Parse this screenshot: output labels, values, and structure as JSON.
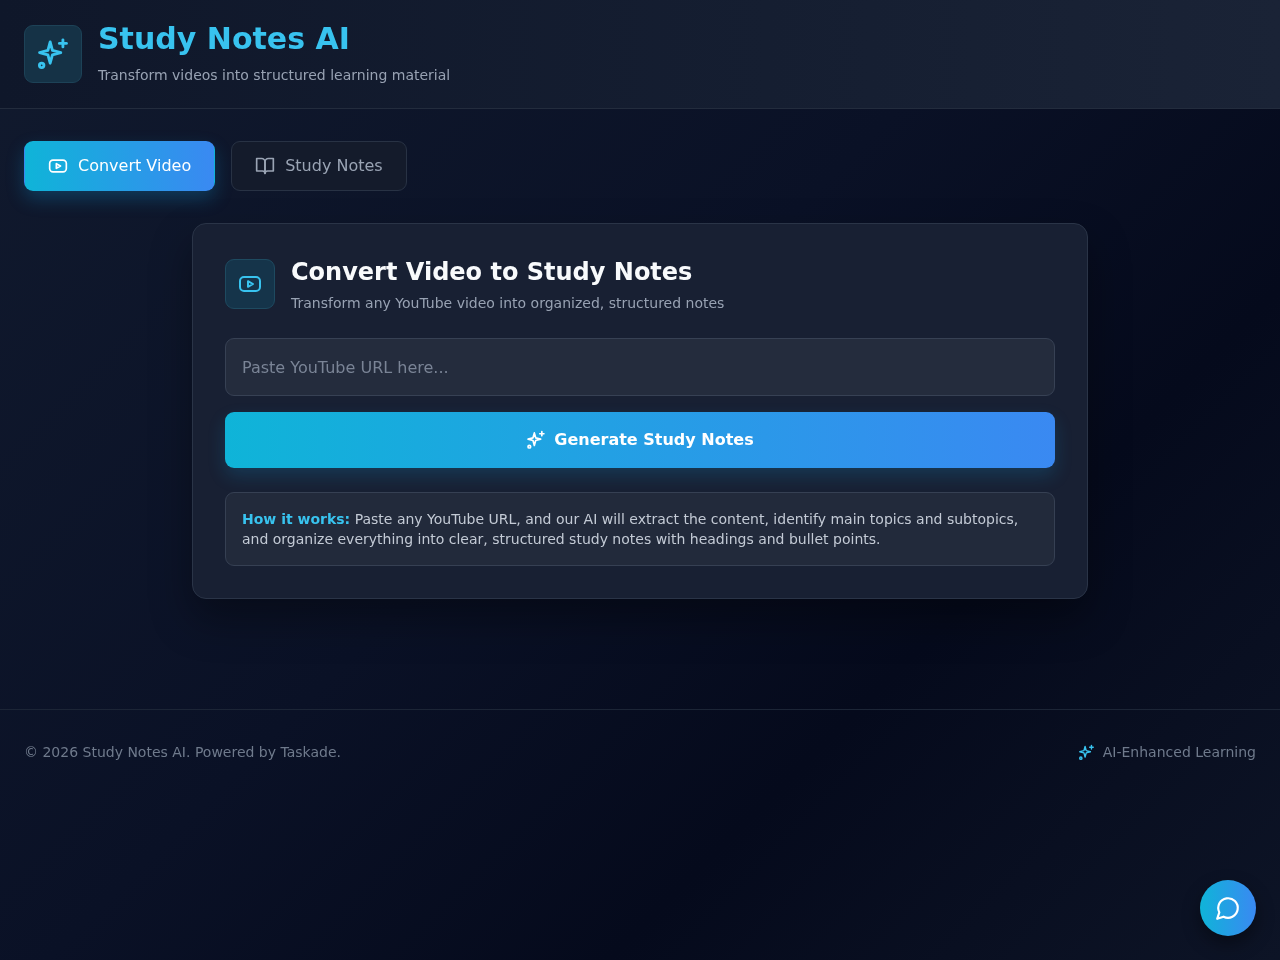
{
  "header": {
    "title": "Study Notes AI",
    "subtitle": "Transform videos into structured learning material"
  },
  "tabs": [
    {
      "label": "Convert Video",
      "selected": true
    },
    {
      "label": "Study Notes",
      "selected": false
    }
  ],
  "convert_card": {
    "title": "Convert Video to Study Notes",
    "subtitle": "Transform any YouTube video into organized, structured notes",
    "url_field": {
      "placeholder": "Paste YouTube URL here..."
    },
    "generate_button": "Generate Study Notes",
    "how_it_works": "**How it works:** Paste any YouTube URL, and our AI will extract the content, identify main topics and subtopics, and organize everything into clear, structured study notes with headings and bullet points."
  },
  "footer": {
    "copyright": "© 2026 Study Notes AI. Powered by Taskade.",
    "tagline": "AI-Enhanced Learning"
  }
}
